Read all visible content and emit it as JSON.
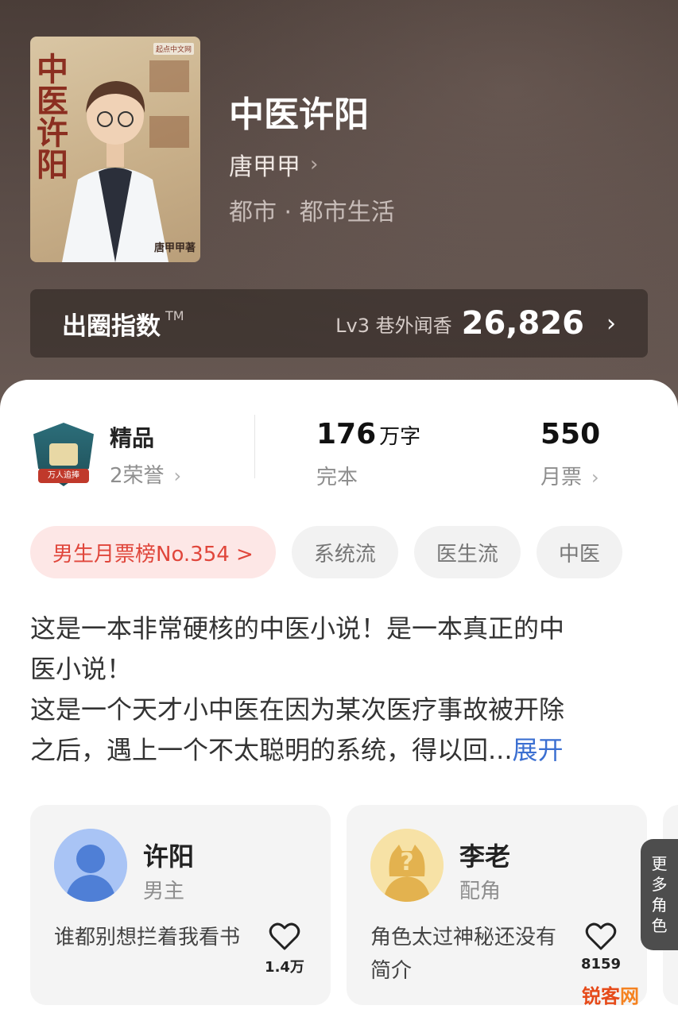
{
  "book": {
    "title": "中医许阳",
    "author": "唐甲甲",
    "genre": "都市 · 都市生活",
    "cover": {
      "vertical_title": "中医许阳",
      "author_sign": "唐甲甲著",
      "publisher_mark": "起点中文网"
    }
  },
  "index_bar": {
    "label": "出圈指数",
    "tm": "TM",
    "level_text": "Lv3 巷外闻香",
    "score": "26,826"
  },
  "stats": {
    "quality": {
      "title": "精品",
      "honors": "2荣誉",
      "badge_text": "万人追捧"
    },
    "words": {
      "number": "176",
      "unit": "万字",
      "status": "完本"
    },
    "tickets": {
      "number": "550",
      "label": "月票"
    }
  },
  "tags": [
    {
      "label": "男生月票榜No.354 >"
    },
    {
      "label": "系统流"
    },
    {
      "label": "医生流"
    },
    {
      "label": "中医"
    }
  ],
  "synopsis": {
    "line1": "这是一本非常硬核的中医小说！是一本真正的中",
    "line2": "医小说！",
    "line3": "这是一个天才小中医在因为某次医疗事故被开除",
    "line4": "之后，遇上一个不太聪明的系统，得以回...",
    "expand": "展开"
  },
  "characters": [
    {
      "name": "许阳",
      "role": "男主",
      "desc": "谁都别想拦着我看书",
      "likes": "1.4万",
      "avatar_icon": "person-silhouette-icon"
    },
    {
      "name": "李老",
      "role": "配角",
      "desc": "角色太过神秘还没有简介",
      "likes": "8159",
      "avatar_icon": "question-mark-icon"
    }
  ],
  "more_roles": "更多角色",
  "watermark": {
    "part1": "锐客",
    "part2": "网"
  },
  "colors": {
    "accent_blue": "#3b6fd1",
    "rank_red": "#e0463b",
    "header_bg": "#4a3d38"
  }
}
